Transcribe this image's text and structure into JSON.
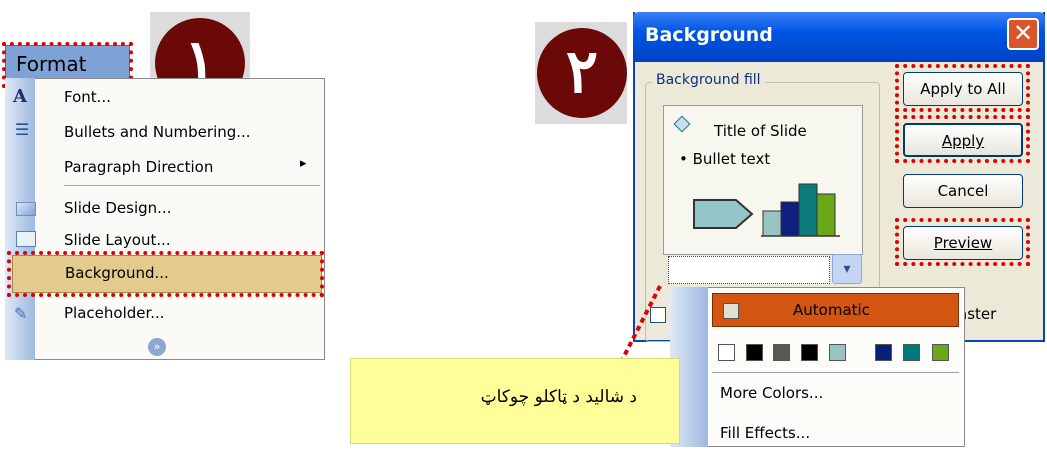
{
  "step_badges": {
    "step1": "١",
    "step2": "٢"
  },
  "format_menu": {
    "title": "Format",
    "items": [
      {
        "label": "Font...",
        "icon": "font-icon"
      },
      {
        "label": "Bullets and Numbering...",
        "icon": "bullets-icon"
      },
      {
        "label": "Paragraph Direction",
        "icon": "",
        "submenu_arrow": "▸"
      },
      {
        "label": "Slide Design...",
        "icon": "slide-design-icon"
      },
      {
        "label": "Slide Layout...",
        "icon": "slide-layout-icon"
      },
      {
        "label": "Background...",
        "icon": ""
      },
      {
        "label": "Placeholder...",
        "icon": "placeholder-icon"
      }
    ],
    "expand_icon": "chevron-double-down-icon"
  },
  "background_dialog": {
    "title": "Background",
    "close_label": "✕",
    "group_label": "Background fill",
    "preview": {
      "title_text": "Title of Slide",
      "bullet_text": "• Bullet text"
    },
    "buttons": {
      "apply_to_all": "Apply to All",
      "apply": "Apply",
      "cancel": "Cancel",
      "preview": "Preview"
    },
    "omit_master_label": "aster"
  },
  "color_dropdown": {
    "automatic": "Automatic",
    "swatches": [
      "#ffffff",
      "#000000",
      "#585858",
      "#000000",
      "#99c2c2",
      "#0a1f7a",
      "#007a7a",
      "#6aa818"
    ],
    "more_colors": "More Colors...",
    "fill_effects": "Fill Effects..."
  },
  "annotation": {
    "text": "د شالید د ټاکلو چوکاټ"
  }
}
